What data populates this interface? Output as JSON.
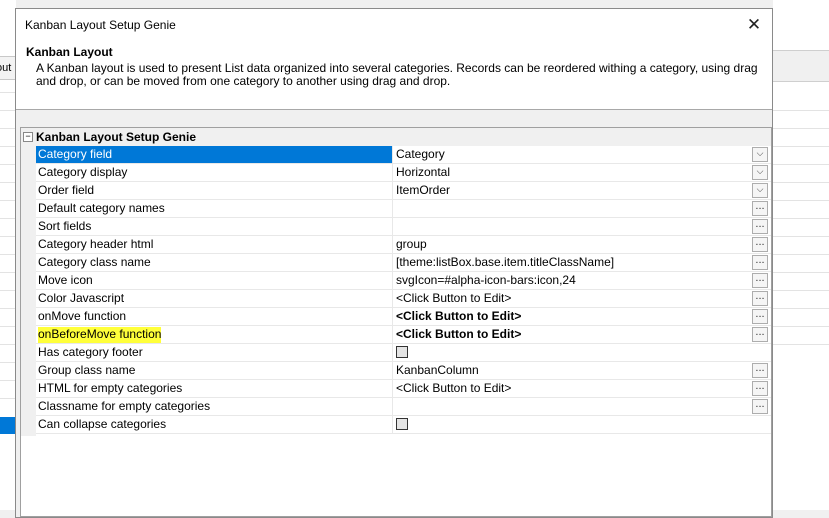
{
  "background": {
    "tab_fragment": "out"
  },
  "dialog": {
    "title": "Kanban Layout Setup Genie",
    "close_glyph": "✕",
    "header_title": "Kanban Layout",
    "header_description": "A Kanban layout is used to present List data organized into several categories. Records can be reordered withing a category, using drag and drop, or can be moved from one category to another using drag and drop."
  },
  "grid": {
    "category": "Kanban Layout Setup Genie",
    "collapse_glyph": "−",
    "highlight_color": "#ffff3a",
    "selection_color": "#0078d7",
    "rows": [
      {
        "name": "Category field",
        "value": "Category",
        "control": "dropdown",
        "selected": true
      },
      {
        "name": "Category display",
        "value": "Horizontal",
        "control": "dropdown"
      },
      {
        "name": "Order field",
        "value": "ItemOrder",
        "control": "dropdown"
      },
      {
        "name": "Default category names",
        "value": "",
        "control": "ellipsis"
      },
      {
        "name": "Sort fields",
        "value": "",
        "control": "ellipsis"
      },
      {
        "name": "Category header html",
        "value": "group",
        "control": "ellipsis"
      },
      {
        "name": "Category class name",
        "value": "[theme:listBox.base.item.titleClassName]",
        "control": "ellipsis"
      },
      {
        "name": "Move icon",
        "value": "svgIcon=#alpha-icon-bars:icon,24",
        "control": "ellipsis"
      },
      {
        "name": "Color Javascript",
        "value": "<Click Button to Edit>",
        "control": "ellipsis"
      },
      {
        "name": "onMove function",
        "value": "<Click Button to Edit>",
        "control": "ellipsis",
        "bold": true
      },
      {
        "name": "onBeforeMove function",
        "value": "<Click Button to Edit>",
        "control": "ellipsis",
        "bold": true,
        "highlighted": true
      },
      {
        "name": "Has category footer",
        "value": "",
        "control": "checkbox"
      },
      {
        "name": "Group class name",
        "value": "KanbanColumn",
        "control": "ellipsis"
      },
      {
        "name": "HTML for empty categories",
        "value": "<Click Button to Edit>",
        "control": "ellipsis"
      },
      {
        "name": "Classname for empty categories",
        "value": "",
        "control": "ellipsis"
      },
      {
        "name": "Can collapse categories",
        "value": "",
        "control": "checkbox"
      }
    ],
    "dropdown_glyph": "⌵",
    "ellipsis_glyph": "..."
  }
}
